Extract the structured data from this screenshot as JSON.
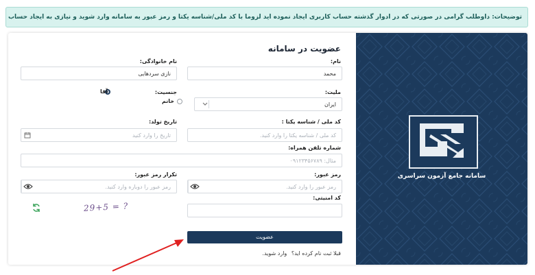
{
  "notice": "توضیحات: داوطلب گرامی در صورتی که در ادوار گذشته حساب کاربری ایجاد نموده اید لزوما با کد ملی/شناسه یکتا و رمز عبور به سامانه وارد شوید و نیازی به ایجاد حساب کاربری مجدد نمی‌باشد.",
  "brand": {
    "title": "سامانه جامع آزمون سراسری",
    "logo_icon": "organization-logo-icon"
  },
  "form": {
    "title": "عضویت در سامانه",
    "first_name": {
      "label": "نام:",
      "value": "محمد"
    },
    "last_name": {
      "label": "نام خانوادگی:",
      "value": "نازی سردهایی"
    },
    "nationality": {
      "label": "ملیت:",
      "value": "ایران"
    },
    "gender": {
      "label": "جنسیت:",
      "options": [
        "آقا",
        "خانم"
      ],
      "selected": "آقا"
    },
    "national_id": {
      "label": "کد ملی / شناسه یکتا :",
      "placeholder": "کد ملی / شناسه یکتا را وارد کنید."
    },
    "birth_date": {
      "label": "تاریخ تولد:",
      "placeholder": "تاریخ را وارد کنید"
    },
    "phone": {
      "label": "شماره تلفن همراه:",
      "placeholder": "مثال: ۰۹۱۲۳۴۵۶۷۸۹"
    },
    "password": {
      "label": "رمز عبور:",
      "placeholder": "رمز عبور را وارد کنید."
    },
    "password_confirm": {
      "label": "تکرار رمز عبور:",
      "placeholder": "رمز عبور را دوباره وارد کنید."
    },
    "captcha": {
      "label": "کد امنیتی:",
      "image_text": "29+5 = ?"
    },
    "submit": "عضویت",
    "login_prompt": "قبلا ثبت نام کرده اید؟",
    "login_link": "وارد شوید."
  },
  "colors": {
    "primary": "#1c3a5c",
    "notice_bg": "#d8f2ee",
    "arrow": "#e02020"
  }
}
